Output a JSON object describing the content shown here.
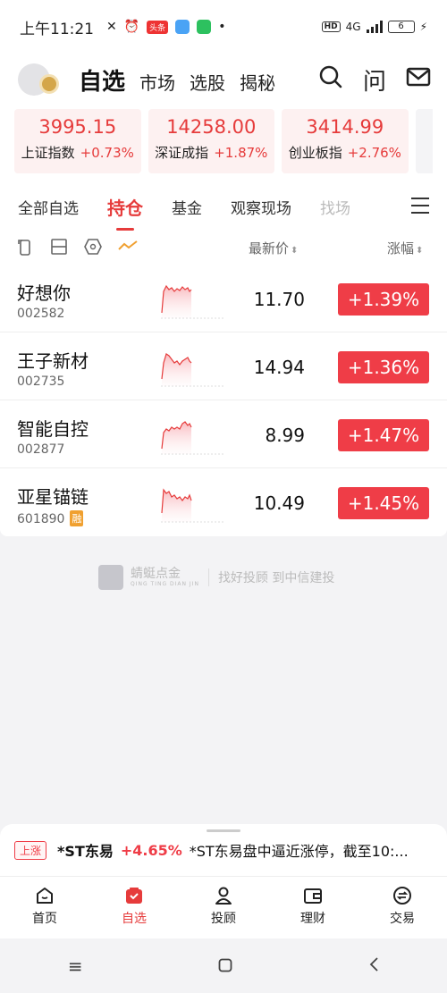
{
  "status": {
    "time": "上午11:21",
    "badge": "头条",
    "net": "4G",
    "battery": "6"
  },
  "header": {
    "tabs": [
      {
        "label": "自选"
      },
      {
        "label": "市场"
      },
      {
        "label": "选股"
      },
      {
        "label": "揭秘"
      }
    ],
    "icons": {
      "search": "search-icon",
      "ask": "问",
      "mail": "mail-icon"
    }
  },
  "indices": [
    {
      "value": "3995.15",
      "name": "上证指数",
      "pct": "+0.73%"
    },
    {
      "value": "14258.00",
      "name": "深证成指",
      "pct": "+1.87%"
    },
    {
      "value": "3414.99",
      "name": "创业板指",
      "pct": "+2.76%"
    }
  ],
  "tabs": [
    {
      "label": "全部自选"
    },
    {
      "label": "持仓"
    },
    {
      "label": "基金"
    },
    {
      "label": "观察现场"
    },
    {
      "label": "找场"
    }
  ],
  "columns": {
    "price": "最新价",
    "change": "涨幅"
  },
  "stocks": [
    {
      "name": "好想你",
      "code": "002582",
      "price": "11.70",
      "change": "+1.39%",
      "tag": ""
    },
    {
      "name": "王子新材",
      "code": "002735",
      "price": "14.94",
      "change": "+1.36%",
      "tag": ""
    },
    {
      "name": "智能自控",
      "code": "002877",
      "price": "8.99",
      "change": "+1.47%",
      "tag": ""
    },
    {
      "name": "亚星锚链",
      "code": "601890",
      "price": "10.49",
      "change": "+1.45%",
      "tag": "融"
    }
  ],
  "watermark": {
    "brand": "蜻蜓点金",
    "brand_en": "QING TING DIAN JIN",
    "slogan": "找好投顾 到中信建投"
  },
  "ticker": {
    "tag": "上涨",
    "stock": "*ST东易",
    "pct": "+4.65%",
    "news": "*ST东易盘中逼近涨停，截至10:..."
  },
  "bottom_nav": [
    {
      "label": "首页",
      "icon": "home-icon"
    },
    {
      "label": "自选",
      "icon": "watchlist-icon"
    },
    {
      "label": "投顾",
      "icon": "advisor-icon"
    },
    {
      "label": "理财",
      "icon": "wallet-icon"
    },
    {
      "label": "交易",
      "icon": "trade-icon"
    }
  ],
  "colors": {
    "accent": "#e63b3b",
    "badge": "#ef3d47"
  }
}
